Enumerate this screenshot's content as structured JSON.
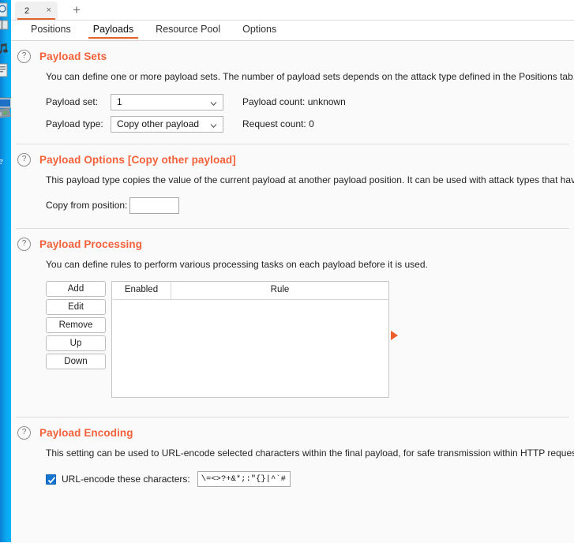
{
  "desktop": {
    "icons": [
      "generic-file-icon",
      "music-note-icon",
      "text-file-icon",
      "computer-icon"
    ],
    "taskbar_glyph": "e",
    "accent_blue": "#0aa8f0"
  },
  "window": {
    "accent_orange": "#e8622b",
    "tabstrip": {
      "tabs": [
        {
          "label": "2",
          "close_glyph": "×",
          "active": true
        }
      ],
      "add_tab_glyph": "+"
    },
    "subtabs": [
      {
        "label": "Positions",
        "active": false
      },
      {
        "label": "Payloads",
        "active": true
      },
      {
        "label": "Resource Pool",
        "active": false
      },
      {
        "label": "Options",
        "active": false
      }
    ]
  },
  "help_glyph": "?",
  "sections": {
    "payload_sets": {
      "title": "Payload Sets",
      "description": "You can define one or more payload sets. The number of payload sets depends on the attack type defined in the Positions tab. V",
      "payload_set_label": "Payload set:",
      "payload_set_value": "1",
      "payload_type_label": "Payload type:",
      "payload_type_value": "Copy other payload",
      "payload_count_label": "Payload count:",
      "payload_count_value": "unknown",
      "request_count_label": "Request count:",
      "request_count_value": "0"
    },
    "payload_options": {
      "title": "Payload Options [Copy other payload]",
      "description": "This payload type copies the value of the current payload at another payload position. It can be used with attack types that have",
      "copy_from_label": "Copy from position:",
      "copy_from_value": ""
    },
    "payload_processing": {
      "title": "Payload Processing",
      "description": "You can define rules to perform various processing tasks on each payload before it is used.",
      "buttons": [
        "Add",
        "Edit",
        "Remove",
        "Up",
        "Down"
      ],
      "columns": [
        "Enabled",
        "Rule"
      ],
      "rows": []
    },
    "payload_encoding": {
      "title": "Payload Encoding",
      "description": "This setting can be used to URL-encode selected characters within the final payload, for safe transmission within HTTP requests.",
      "checkbox_checked": true,
      "checkbox_label": "URL-encode these characters:",
      "characters_value": "\\=<>?+&*;:\"{}|^`#"
    }
  }
}
